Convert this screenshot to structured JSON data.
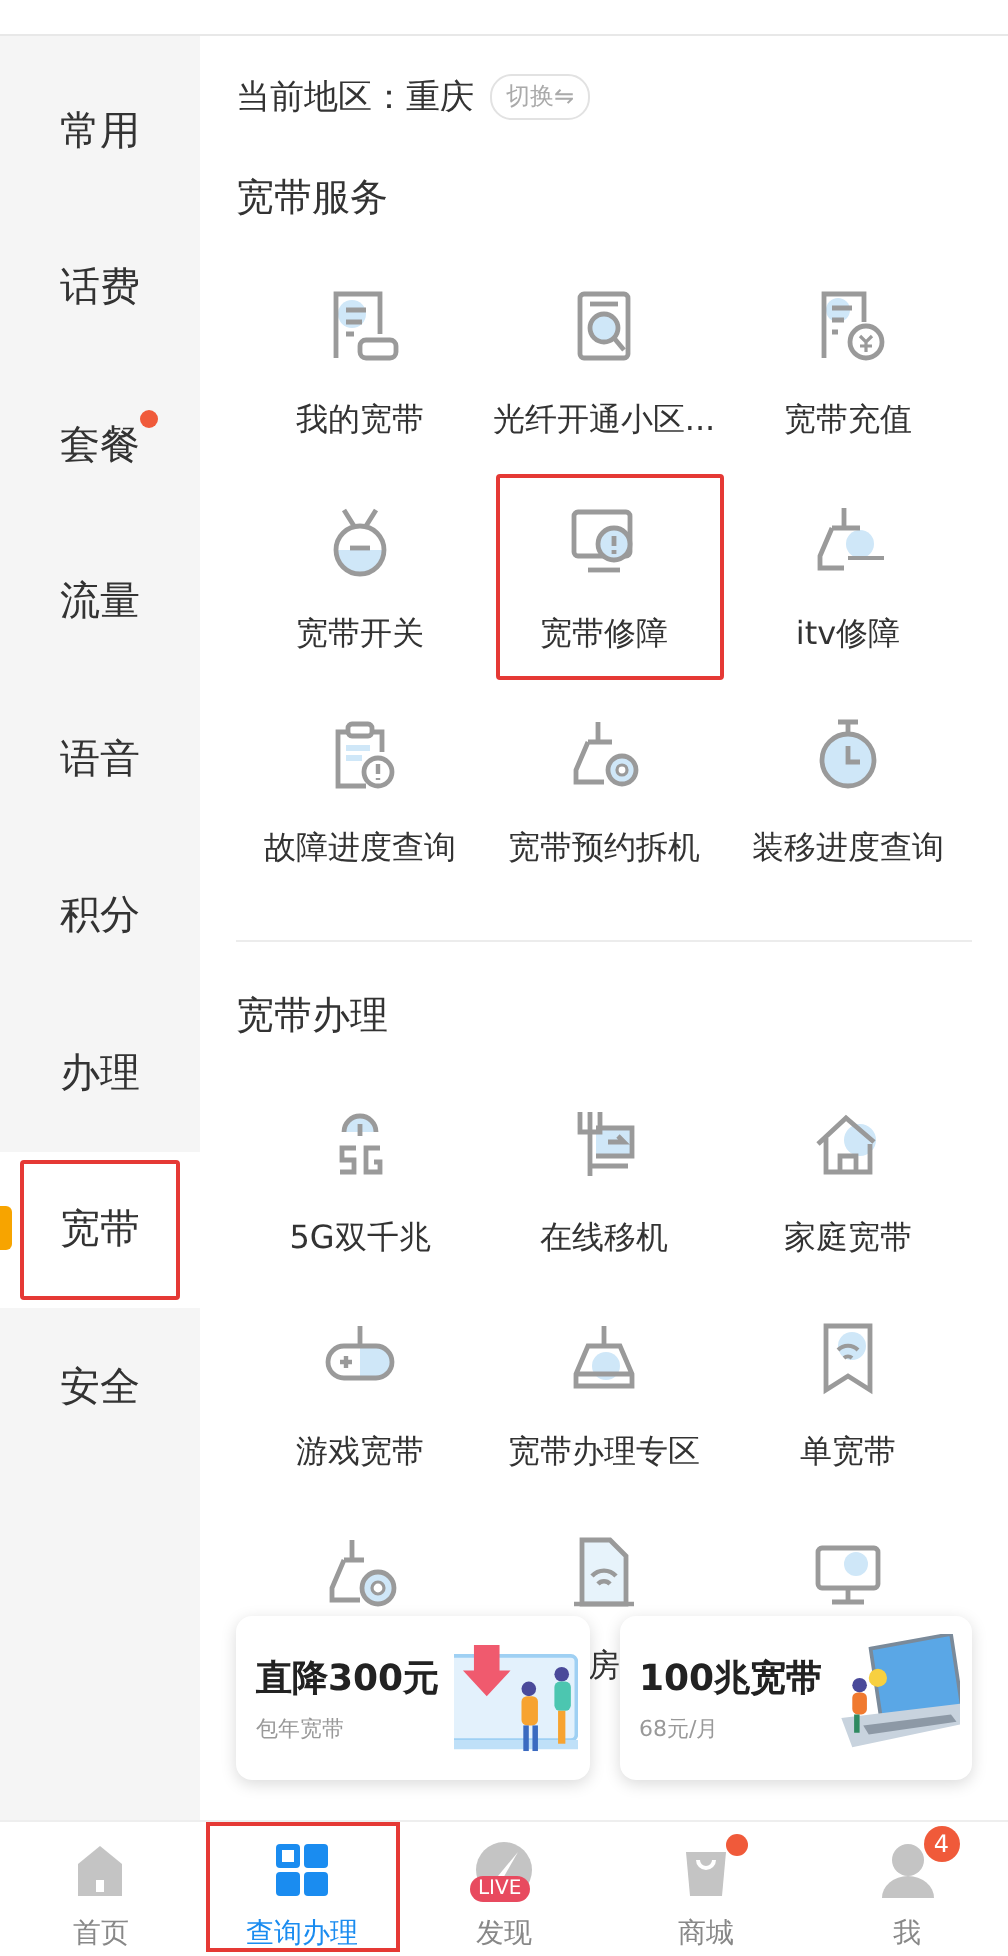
{
  "sidebar": {
    "items": [
      {
        "label": "常用",
        "selected": false,
        "highlighted": false,
        "dot": false
      },
      {
        "label": "话费",
        "selected": false,
        "highlighted": false,
        "dot": false
      },
      {
        "label": "套餐",
        "selected": false,
        "highlighted": false,
        "dot": true
      },
      {
        "label": "流量",
        "selected": false,
        "highlighted": false,
        "dot": false
      },
      {
        "label": "语音",
        "selected": false,
        "highlighted": false,
        "dot": false
      },
      {
        "label": "积分",
        "selected": false,
        "highlighted": false,
        "dot": false
      },
      {
        "label": "办理",
        "selected": false,
        "highlighted": false,
        "dot": false
      },
      {
        "label": "宽带",
        "selected": true,
        "highlighted": true,
        "dot": false
      },
      {
        "label": "安全",
        "selected": false,
        "highlighted": false,
        "dot": false
      }
    ]
  },
  "region": {
    "label": "当前地区：重庆",
    "switch_button": "切换⇋"
  },
  "sections": [
    {
      "title": "宽带服务",
      "items": [
        {
          "label": "我的宽带",
          "highlighted": false
        },
        {
          "label": "光纤开通小区...",
          "highlighted": false
        },
        {
          "label": "宽带充值",
          "highlighted": false
        },
        {
          "label": "宽带开关",
          "highlighted": false
        },
        {
          "label": "宽带修障",
          "highlighted": true
        },
        {
          "label": "itv修障",
          "highlighted": false
        },
        {
          "label": "故障进度查询",
          "highlighted": false
        },
        {
          "label": "宽带预约拆机",
          "highlighted": false
        },
        {
          "label": "装移进度查询",
          "highlighted": false
        }
      ]
    },
    {
      "title": "宽带办理",
      "items": [
        {
          "label": "5G双千兆",
          "highlighted": false
        },
        {
          "label": "在线移机",
          "highlighted": false
        },
        {
          "label": "家庭宽带",
          "highlighted": false
        },
        {
          "label": "游戏宽带",
          "highlighted": false
        },
        {
          "label": "宽带办理专区",
          "highlighted": false
        },
        {
          "label": "单宽带",
          "highlighted": false
        },
        {
          "highlighted": false
        },
        {
          "label": "房",
          "highlighted": false
        },
        {
          "highlighted": false
        }
      ]
    }
  ],
  "promos": [
    {
      "title": "直降300元",
      "subtitle": "包年宽带"
    },
    {
      "title": "100兆宽带",
      "subtitle": "68元/月"
    }
  ],
  "tab_bar": [
    {
      "label": "首页",
      "selected": false,
      "highlighted": false,
      "dot": false
    },
    {
      "label": "查询办理",
      "selected": true,
      "highlighted": true,
      "dot": false
    },
    {
      "label": "发现",
      "selected": false,
      "highlighted": false,
      "dot": false,
      "icon_badge": "LIVE"
    },
    {
      "label": "商城",
      "selected": false,
      "highlighted": false,
      "dot": true
    },
    {
      "label": "我",
      "selected": false,
      "highlighted": false,
      "dot": false,
      "badge": "4"
    }
  ]
}
